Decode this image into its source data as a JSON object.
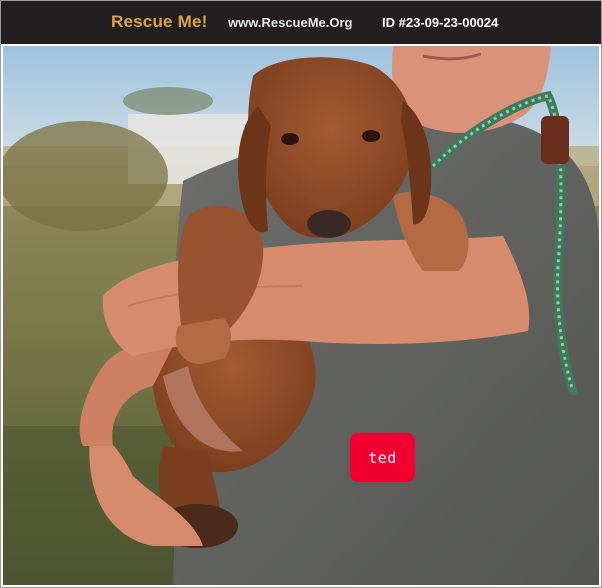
{
  "header": {
    "brand": "Rescue Me!",
    "site": "www.RescueMe.Org",
    "listing_id": "ID #23-09-23-00024"
  },
  "photo": {
    "subject": "dog-photo",
    "name_tag": "ted"
  },
  "colors": {
    "header_bg": "#231f20",
    "brand": "#d9a441",
    "name_tag": "#f2002f"
  }
}
